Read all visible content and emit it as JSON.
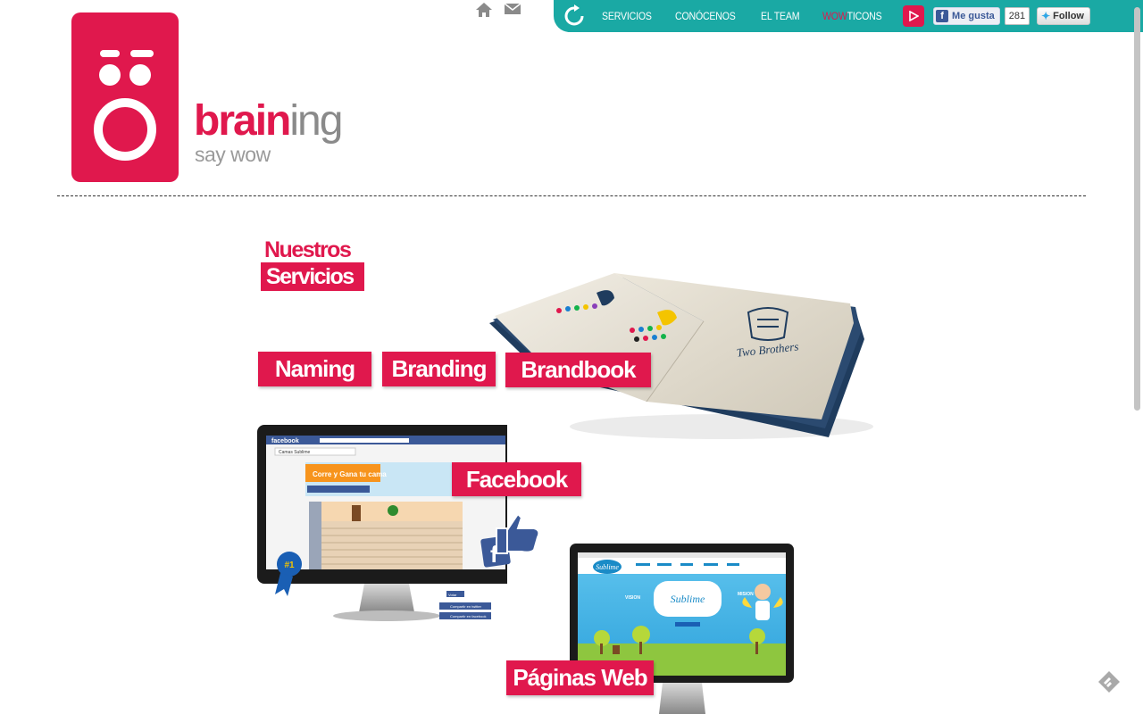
{
  "top_icons": {
    "home": "home-icon",
    "mail": "mail-icon"
  },
  "nav": {
    "items": [
      {
        "label": "SERVICIOS"
      },
      {
        "label": "CONÓCENOS"
      },
      {
        "label": "EL TEAM"
      }
    ],
    "wow_part1": "WOW",
    "wow_part2": "TICONS",
    "fb_like_label": "Me gusta",
    "fb_like_count": "281",
    "tw_follow_label": "Follow"
  },
  "logo": {
    "word_part1": "brain",
    "word_part2": "ing",
    "tagline": "say wow"
  },
  "services": {
    "title_line1": "Nuestros",
    "title_line2": "Servicios",
    "tags": {
      "naming": "Naming",
      "branding": "Branding",
      "brandbook": "Brandbook",
      "facebook": "Facebook",
      "web": "Páginas Web"
    },
    "book_text": "Two Brothers",
    "fb_screen": {
      "brand": "facebook",
      "page_name": "Camas Sublime",
      "promo": "Corre y Gana tu cama",
      "badge": "#1",
      "share_twitter": "Compartir en twitter",
      "share_facebook": "Compartir en facebook",
      "like_btn": "Votar"
    },
    "web_screen": {
      "brand": "Sublime",
      "vision": "VISION",
      "mision": "MISION"
    }
  },
  "colors": {
    "brand_pink": "#e0184d",
    "nav_teal": "#1aa9a4"
  }
}
